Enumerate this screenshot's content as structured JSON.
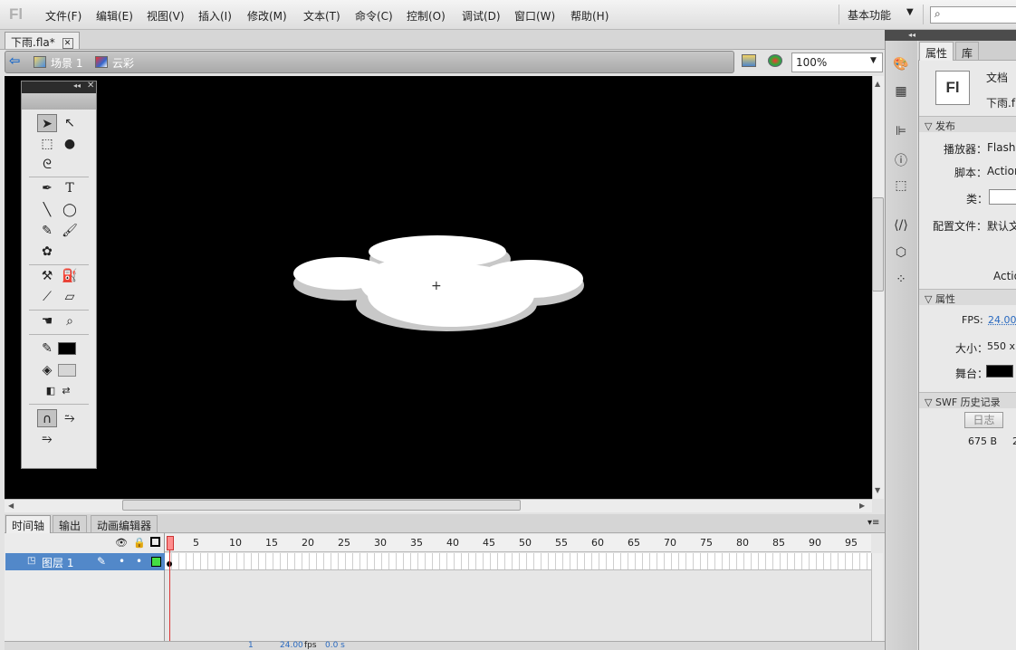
{
  "app": {
    "logo": "Fl"
  },
  "menu": {
    "items": [
      "文件(F)",
      "编辑(E)",
      "视图(V)",
      "插入(I)",
      "修改(M)",
      "文本(T)",
      "命令(C)",
      "控制(O)",
      "调试(D)",
      "窗口(W)",
      "帮助(H)"
    ],
    "workspace": "基本功能",
    "search_placeholder": ""
  },
  "document": {
    "tab_label": "下雨.fla*",
    "close_glyph": "✕"
  },
  "editbar": {
    "scene_label": "场景 1",
    "symbol_label": "云彩",
    "zoom": "100%"
  },
  "tools": {
    "pen_glyph": "✎",
    "text_tool": "T",
    "hand": "✋",
    "zoom": "🔍"
  },
  "timeline": {
    "tabs": [
      "时间轴",
      "输出",
      "动画编辑器"
    ],
    "layer_name": "图层 1",
    "frame_numbers": [
      "1",
      "5",
      "10",
      "15",
      "20",
      "25",
      "30",
      "35",
      "40",
      "45",
      "50",
      "55",
      "60",
      "65",
      "70",
      "75",
      "80",
      "85",
      "90",
      "95"
    ],
    "status_frame": "1",
    "status_fps": "24.00",
    "fps_unit": "fps",
    "status_time": "0.0 s"
  },
  "properties": {
    "tabs": [
      "属性",
      "库"
    ],
    "doc_type": "文档",
    "doc_name": "下雨.f",
    "publish_section": "发布",
    "player_label": "播放器：",
    "player_value": "Flash",
    "script_label": "脚本：",
    "script_value": "Action",
    "class_label": "类：",
    "profile_label": "配置文件：",
    "profile_value": "默认文",
    "action_partial": "Actio",
    "props_section": "属性",
    "fps_label": "FPS:",
    "fps_value": "24.00",
    "size_label": "大小：",
    "size_value": "550 x",
    "stage_label": "舞台：",
    "swf_section": "SWF 历史记录",
    "log_button": "日志",
    "swf_size": "675 B",
    "swf_extra": "2"
  },
  "colors": {
    "stage_bg": "#000000",
    "cloud_fill": "#ffffff",
    "cloud_shadow": "#c8c8c8",
    "layer_selected": "#5288c9"
  }
}
